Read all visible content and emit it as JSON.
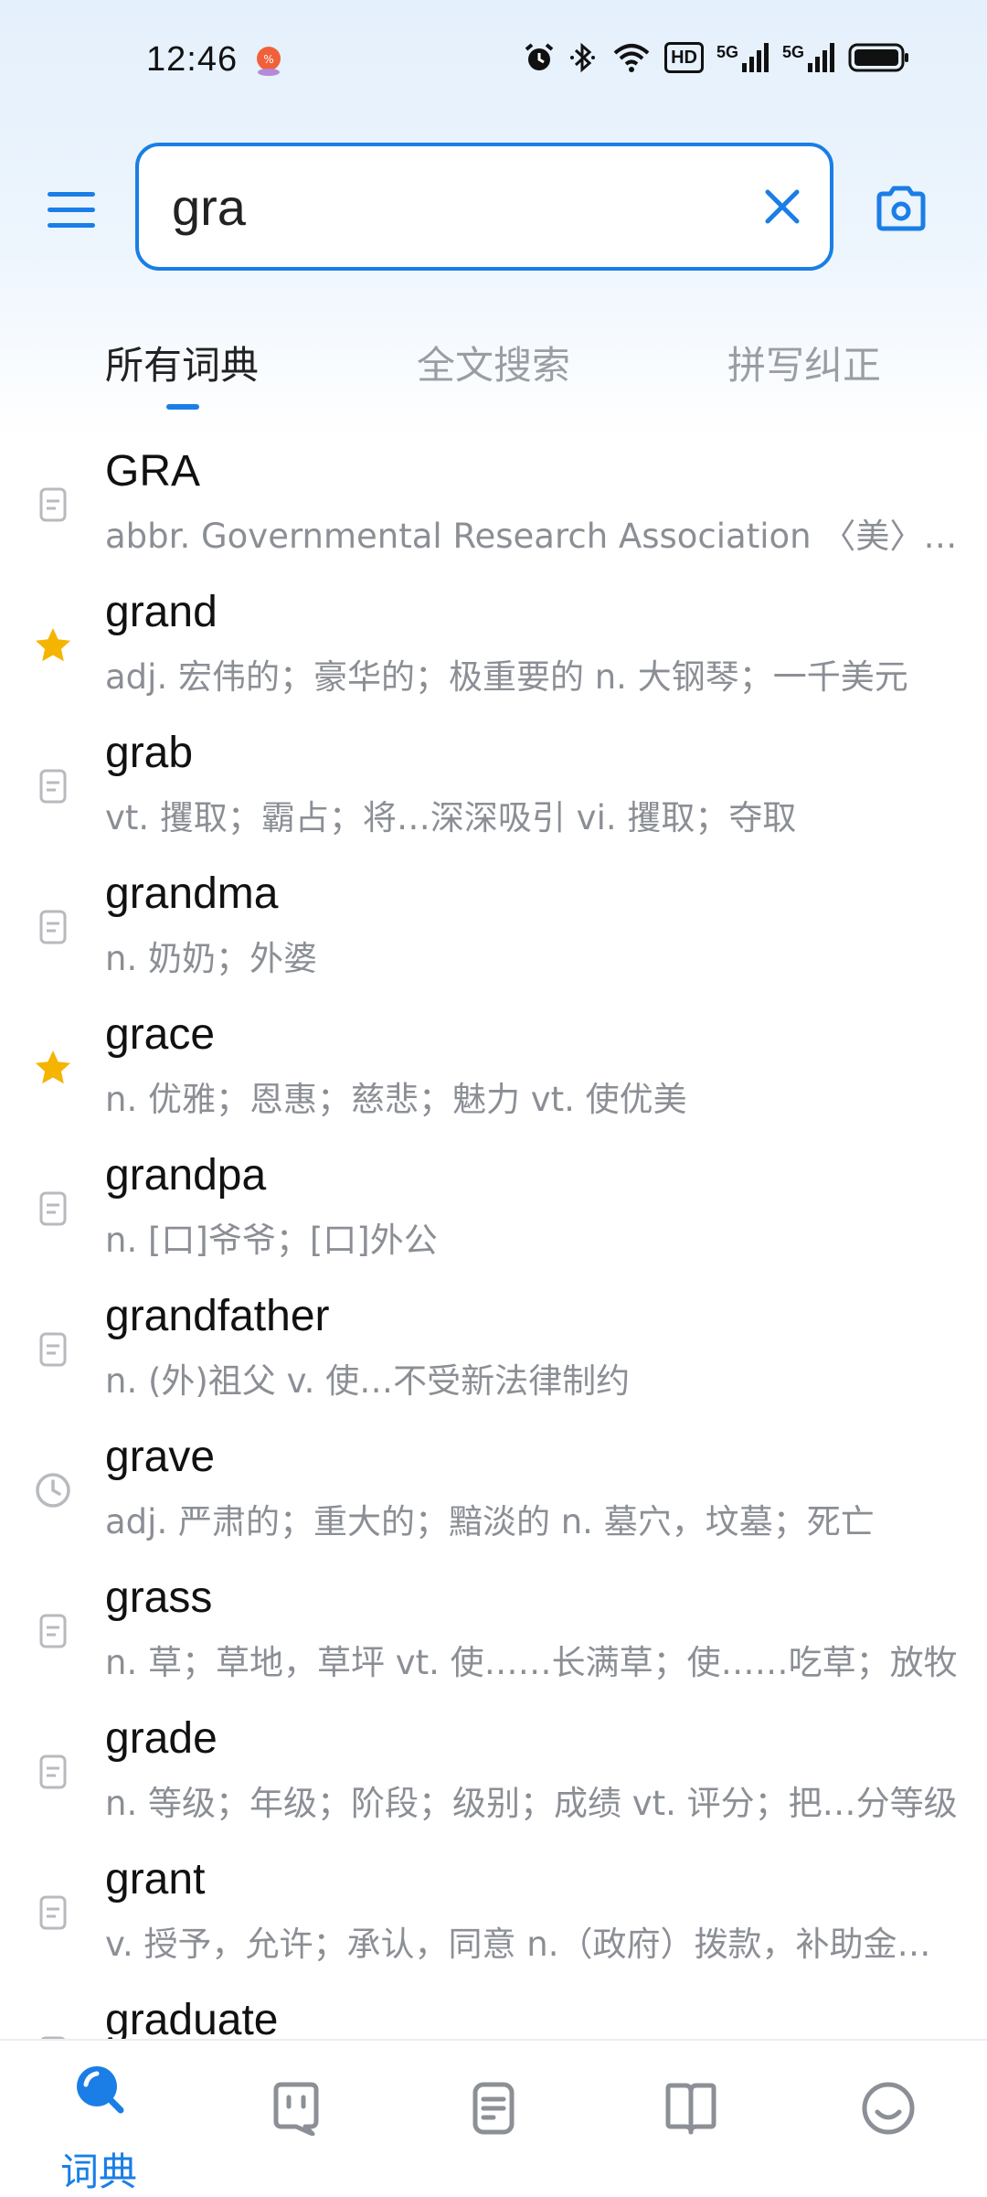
{
  "status_bar": {
    "time": "12:46",
    "network_5g": "5G",
    "hd_label": "HD"
  },
  "search": {
    "value": "gra",
    "menu_icon": "menu-icon",
    "clear_icon": "close-icon",
    "camera_icon": "camera-icon"
  },
  "tabs": [
    {
      "label": "所有词典",
      "active": true
    },
    {
      "label": "全文搜索",
      "active": false
    },
    {
      "label": "拼写纠正",
      "active": false
    }
  ],
  "results": [
    {
      "word": "GRA",
      "definition": "abbr. Governmental Research Association 〈美〉政府研究协会",
      "icon": "document-icon"
    },
    {
      "word": "grand",
      "definition": "adj. 宏伟的；豪华的；极重要的 n. 大钢琴；一千美元",
      "icon": "star-icon"
    },
    {
      "word": "grab",
      "definition": "vt. 攫取；霸占；将…深深吸引 vi. 攫取；夺取",
      "icon": "document-icon"
    },
    {
      "word": "grandma",
      "definition": "n. 奶奶；外婆",
      "icon": "document-icon"
    },
    {
      "word": "grace",
      "definition": "n. 优雅；恩惠；慈悲；魅力 vt. 使优美",
      "icon": "star-icon"
    },
    {
      "word": "grandpa",
      "definition": "n. [口]爷爷；[口]外公",
      "icon": "document-icon"
    },
    {
      "word": "grandfather",
      "definition": "n. (外)祖父 v. 使…不受新法律制约",
      "icon": "document-icon"
    },
    {
      "word": "grave",
      "definition": "adj. 严肃的；重大的；黯淡的 n. 墓穴，坟墓；死亡",
      "icon": "clock-icon"
    },
    {
      "word": "grass",
      "definition": "n. 草；草地，草坪 vt. 使……长满草；使……吃草；放牧",
      "icon": "document-icon"
    },
    {
      "word": "grade",
      "definition": "n. 等级；年级；阶段；级别；成绩 vt. 评分；把…分等级",
      "icon": "document-icon"
    },
    {
      "word": "grant",
      "definition": "v. 授予，允许；承认，同意 n.（政府）拨款，补助金；授予物",
      "icon": "document-icon"
    },
    {
      "word": "graduate",
      "definition": "",
      "icon": "document-icon"
    }
  ],
  "bottom_nav": [
    {
      "label": "词典",
      "icon": "search-icon",
      "active": true
    },
    {
      "label": "",
      "icon": "chat-icon",
      "active": false
    },
    {
      "label": "",
      "icon": "notes-icon",
      "active": false
    },
    {
      "label": "",
      "icon": "book-icon",
      "active": false
    },
    {
      "label": "",
      "icon": "smiley-icon",
      "active": false
    }
  ],
  "colors": {
    "accent": "#1a7ee6",
    "star": "#f5b400",
    "secondary_text": "#8b8f95",
    "inactive_tab": "#9a9ea4",
    "icon_gray": "#b7babe"
  }
}
